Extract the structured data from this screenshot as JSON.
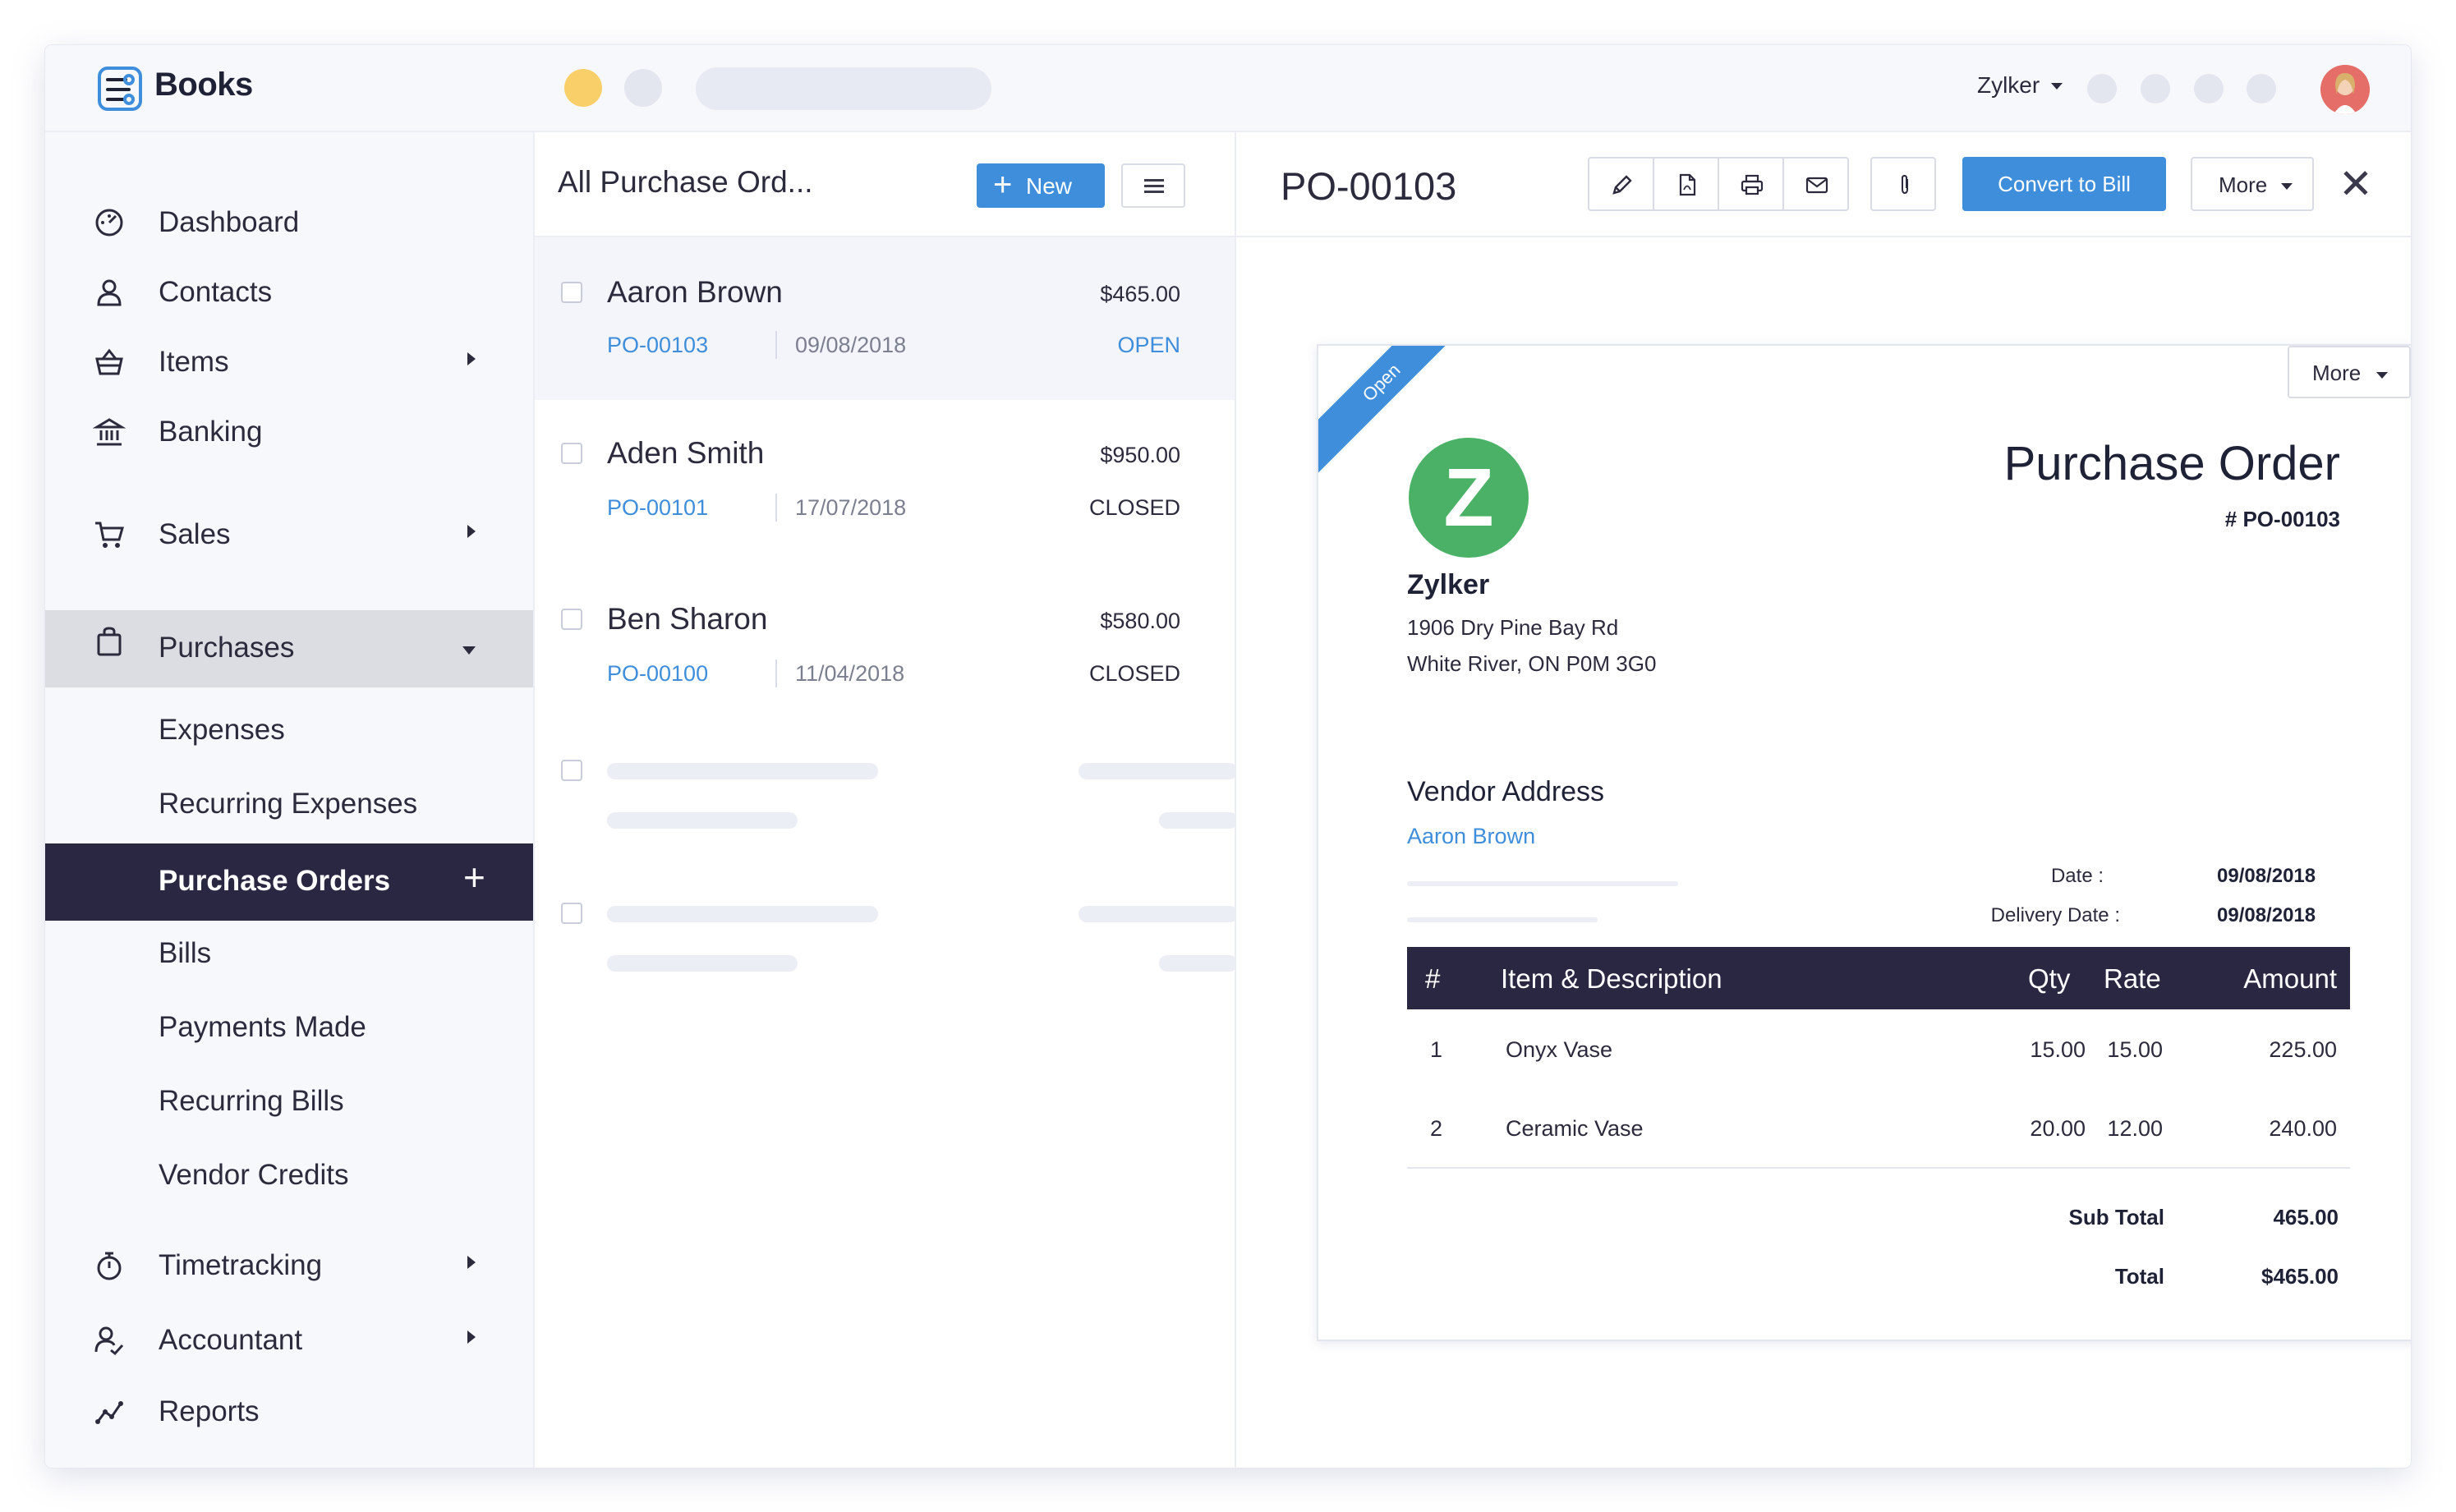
{
  "app": {
    "brand": "Books",
    "user_name": "Zylker"
  },
  "sidebar": {
    "items": [
      {
        "label": "Dashboard",
        "icon": "dashboard-icon"
      },
      {
        "label": "Contacts",
        "icon": "contacts-icon"
      },
      {
        "label": "Items",
        "icon": "items-icon"
      },
      {
        "label": "Banking",
        "icon": "banking-icon"
      },
      {
        "label": "Sales",
        "icon": "cart-icon"
      },
      {
        "label": "Purchases",
        "icon": "bag-icon"
      },
      {
        "label": "Timetracking",
        "icon": "stopwatch-icon"
      },
      {
        "label": "Accountant",
        "icon": "accountant-icon"
      },
      {
        "label": "Reports",
        "icon": "reports-icon"
      }
    ],
    "purchases_sub": [
      "Expenses",
      "Recurring Expenses",
      "Purchase Orders",
      "Bills",
      "Payments Made",
      "Recurring Bills",
      "Vendor Credits"
    ],
    "plus_symbol": "+"
  },
  "list": {
    "title": "All Purchase Ord...",
    "new_label": "New",
    "new_plus": "+",
    "rows": [
      {
        "vendor": "Aaron Brown",
        "amount": "$465.00",
        "po": "PO-00103",
        "date": "09/08/2018",
        "status": "OPEN",
        "status_color": "#3f8edc"
      },
      {
        "vendor": "Aden Smith",
        "amount": "$950.00",
        "po": "PO-00101",
        "date": "17/07/2018",
        "status": "CLOSED",
        "status_color": "#2b2b3d"
      },
      {
        "vendor": "Ben Sharon",
        "amount": "$580.00",
        "po": "PO-00100",
        "date": "11/04/2018",
        "status": "CLOSED",
        "status_color": "#2b2b3d"
      }
    ]
  },
  "detail": {
    "title": "PO-00103",
    "convert_label": "Convert to Bill",
    "more_label": "More",
    "close_symbol": "✕"
  },
  "document": {
    "ribbon": "Open",
    "more_label": "More",
    "logo_letter": "Z",
    "company": "Zylker",
    "address_line1": "1906 Dry Pine Bay Rd",
    "address_line2": "White River, ON P0M 3G0",
    "heading": "Purchase Order",
    "number": "# PO-00103",
    "vendor_address_label": "Vendor Address",
    "vendor_name": "Aaron Brown",
    "date_label": "Date :",
    "date_value": "09/08/2018",
    "delivery_label": "Delivery Date :",
    "delivery_value": "09/08/2018",
    "table_headers": {
      "num": "#",
      "item": "Item & Description",
      "qty": "Qty",
      "rate": "Rate",
      "amount": "Amount"
    },
    "lines": [
      {
        "num": "1",
        "item": "Onyx Vase",
        "qty": "15.00",
        "rate": "15.00",
        "amount": "225.00"
      },
      {
        "num": "2",
        "item": "Ceramic Vase",
        "qty": "20.00",
        "rate": "12.00",
        "amount": "240.00"
      }
    ],
    "subtotal_label": "Sub Total",
    "subtotal_value": "465.00",
    "total_label": "Total",
    "total_value": "$465.00"
  },
  "colors": {
    "accent": "#3f8edc",
    "selected_nav": "#2a2743",
    "logo_green": "#4bb166"
  }
}
